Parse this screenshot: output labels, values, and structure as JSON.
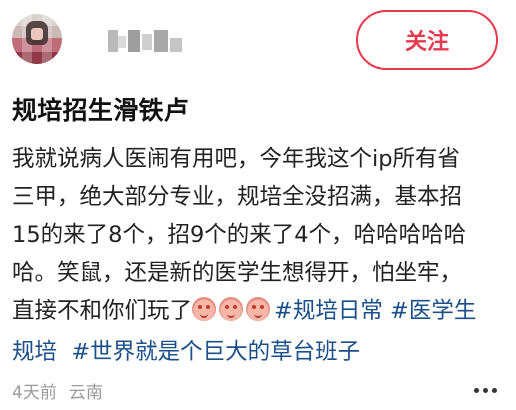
{
  "post": {
    "author": {
      "avatar_icon": "user-avatar-icon",
      "name_obscured": true
    },
    "follow_label": "关注",
    "title": "规培招生滑铁卢",
    "content_lines": [
      "我就说病人医闹有用吧，今年我这个ip所有省",
      "三甲，绝大部分专业，规培全没招满，基本招",
      "15的来了8个，招9个的来了4个，哈哈哈哈哈",
      "哈。笑鼠，还是新的医学生想得开，怕坐牢，"
    ],
    "line5_text": "直接不和你们玩了",
    "tags": [
      "#规培日常",
      "#医学生规培",
      "#世界就是个巨大的草台班子"
    ],
    "tag_line5": "#规培日常 #医学生",
    "tag_line6_a": "规培",
    "tag_line6_b": "#世界就是个巨大的草台班子",
    "emoji_icons": [
      "crying-face-icon",
      "crying-face-icon",
      "crying-face-icon"
    ],
    "time": "4天前",
    "location": "云南",
    "more_icon": "more-icon"
  },
  "colors": {
    "accent": "#e8384f",
    "tag": "#1a4f8a",
    "meta": "#9a9a9a"
  }
}
